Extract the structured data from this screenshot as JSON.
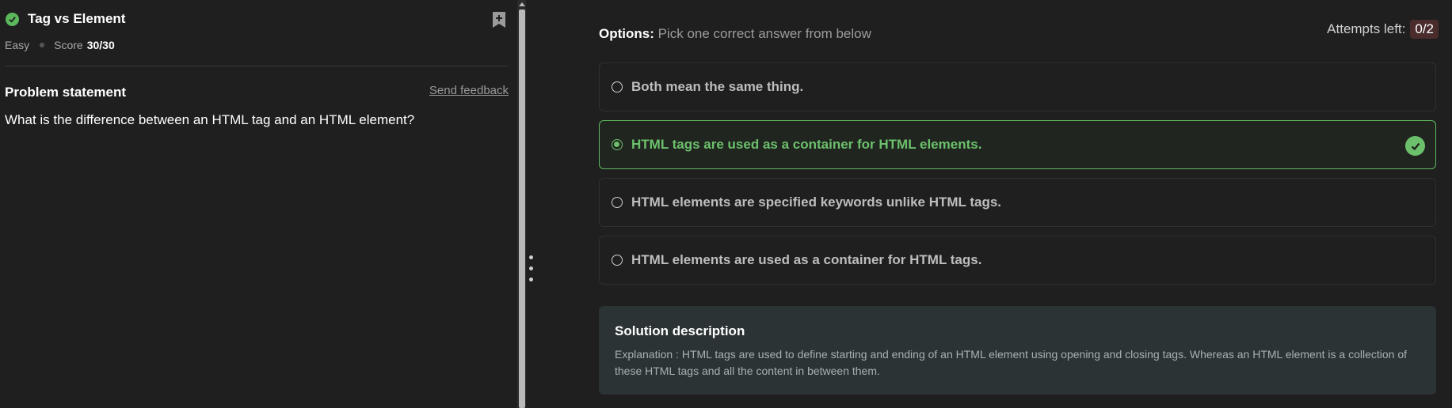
{
  "problem": {
    "title": "Tag vs Element",
    "difficulty": "Easy",
    "score_label": "Score",
    "score_value": "30/30",
    "statement_heading": "Problem statement",
    "feedback_link": "Send feedback",
    "question": "What is the difference between an HTML tag and an HTML element?"
  },
  "options_header": {
    "label": "Options:",
    "hint": "Pick one correct answer from below"
  },
  "attempts": {
    "label": "Attempts left:",
    "value": "0/2"
  },
  "options": [
    {
      "text": "Both mean the same thing.",
      "selected": false,
      "correct": false
    },
    {
      "text": "HTML tags are used as a container for HTML elements.",
      "selected": true,
      "correct": true
    },
    {
      "text": "HTML elements are specified keywords unlike HTML tags.",
      "selected": false,
      "correct": false
    },
    {
      "text": "HTML elements are used as a container for HTML tags.",
      "selected": false,
      "correct": false
    }
  ],
  "solution": {
    "heading": "Solution description",
    "text": "Explanation : HTML tags are used to define starting and ending of an HTML element using opening and closing tags. Whereas an HTML element is a collection of these HTML tags and all the content in between them."
  },
  "colors": {
    "accent_green": "#6cc06c",
    "background": "#1f1f1f",
    "solution_bg": "#2b3335",
    "attempts_badge": "#4a2c2c"
  }
}
